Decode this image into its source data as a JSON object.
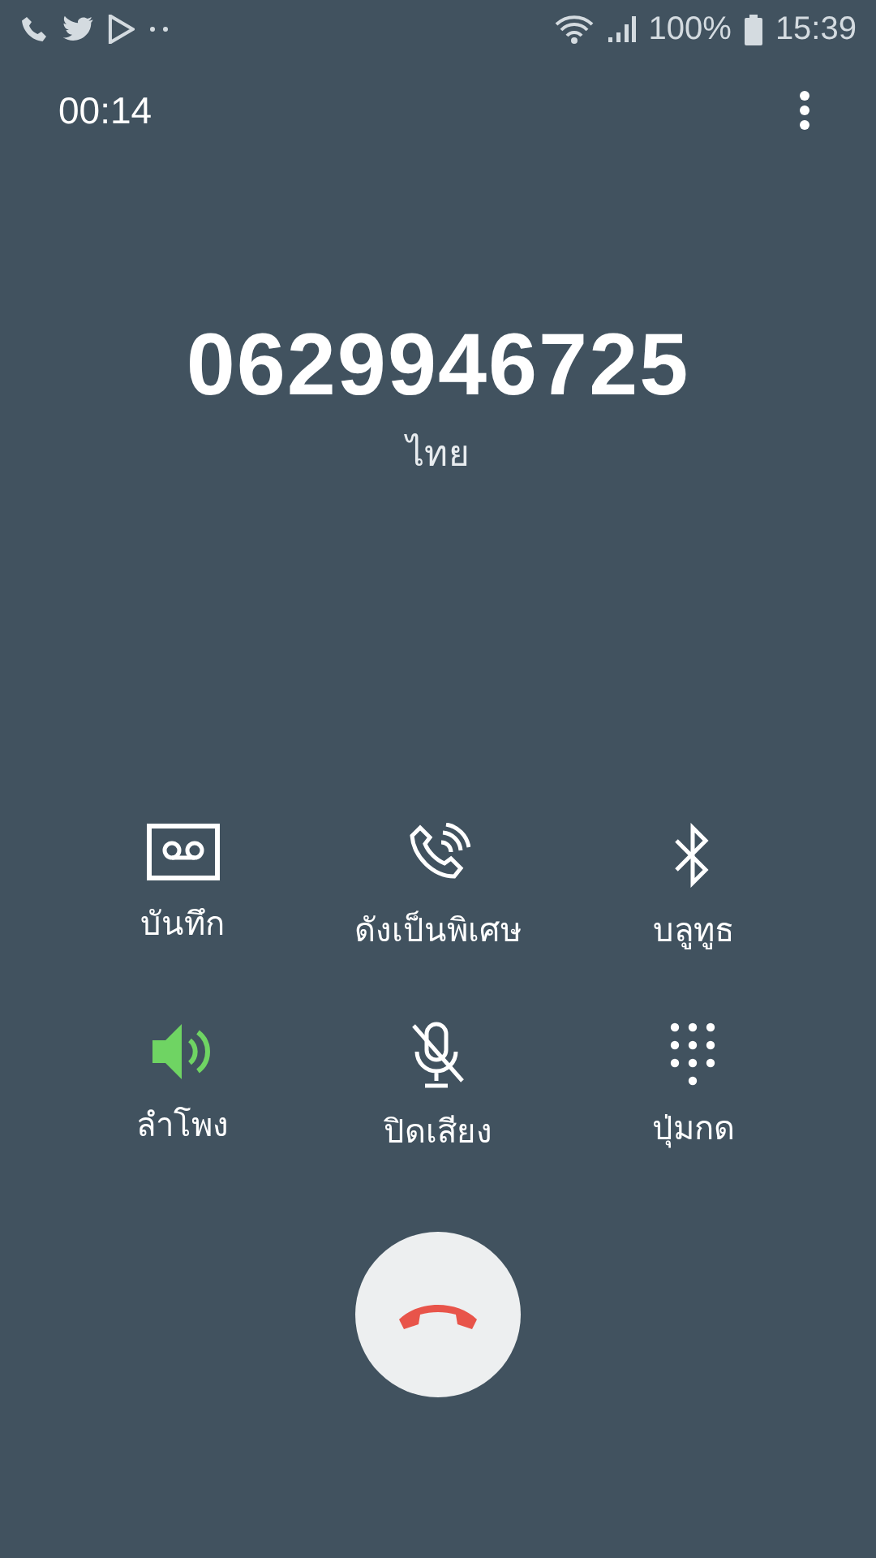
{
  "status_bar": {
    "notifications": [
      {
        "kind": "phone"
      },
      {
        "kind": "bird"
      },
      {
        "kind": "play"
      },
      {
        "kind": "more"
      }
    ],
    "battery": "100%",
    "time": "15:39"
  },
  "call": {
    "duration": "00:14",
    "number": "0629946725",
    "location": "ไทย"
  },
  "controls": [
    {
      "kind": "record",
      "label": "บันทึก",
      "on": false
    },
    {
      "kind": "extra_volume",
      "label": "ดังเป็นพิเศษ",
      "on": false
    },
    {
      "kind": "bluetooth",
      "label": "บลูทูธ",
      "on": false
    },
    {
      "kind": "speaker",
      "label": "ลำโพง",
      "on": true
    },
    {
      "kind": "mute",
      "label": "ปิดเสียง",
      "on": false
    },
    {
      "kind": "keypad",
      "label": "ปุ่มกด",
      "on": false
    }
  ]
}
